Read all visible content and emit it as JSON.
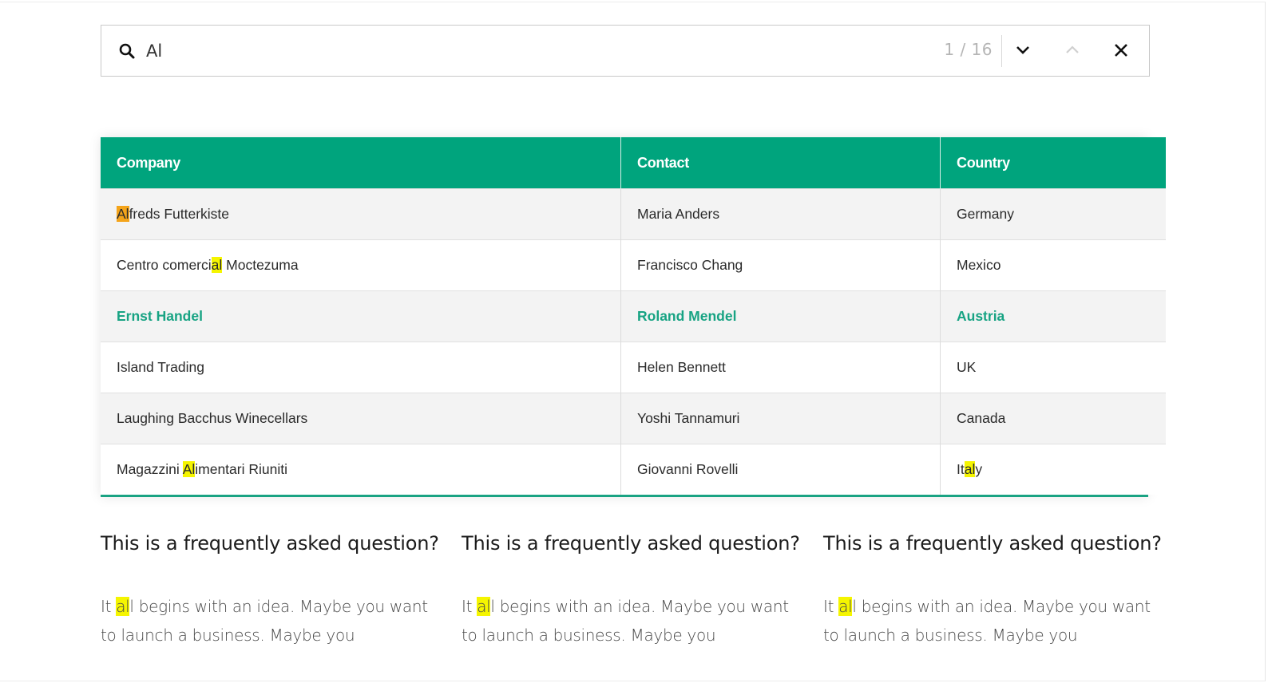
{
  "find_bar": {
    "query": "Al",
    "placeholder": "",
    "match_current": 1,
    "match_total": 16,
    "count_text": "1 / 16",
    "icons": {
      "search": "search-icon",
      "next": "chevron-down-icon",
      "prev": "chevron-up-icon",
      "close": "close-icon"
    }
  },
  "table": {
    "columns": [
      "Company",
      "Contact",
      "Country"
    ],
    "rows": [
      {
        "company": {
          "pre": "",
          "hl": "Al",
          "post": "freds Futterkiste",
          "current": true
        },
        "contact": "Maria Anders",
        "country": {
          "pre": "Germany",
          "hl": "",
          "post": ""
        }
      },
      {
        "company": {
          "pre": "Centro comerci",
          "hl": "al",
          "post": " Moctezuma"
        },
        "contact": "Francisco Chang",
        "country": {
          "pre": "Mexico",
          "hl": "",
          "post": ""
        }
      },
      {
        "company": {
          "pre": "Ernst Handel",
          "hl": "",
          "post": ""
        },
        "contact": "Roland Mendel",
        "country": {
          "pre": "Austria",
          "hl": "",
          "post": ""
        },
        "selected": true
      },
      {
        "company": {
          "pre": "Island Trading",
          "hl": "",
          "post": ""
        },
        "contact": "Helen Bennett",
        "country": {
          "pre": "UK",
          "hl": "",
          "post": ""
        }
      },
      {
        "company": {
          "pre": "Laughing Bacchus Winecellars",
          "hl": "",
          "post": ""
        },
        "contact": "Yoshi Tannamuri",
        "country": {
          "pre": "Canada",
          "hl": "",
          "post": ""
        }
      },
      {
        "company": {
          "pre": "Magazzini ",
          "hl": "Al",
          "post": "imentari Riuniti"
        },
        "contact": "Giovanni Rovelli",
        "country": {
          "pre": "It",
          "hl": "al",
          "post": "y"
        }
      }
    ]
  },
  "faq": [
    {
      "question": "This is a frequently asked question?",
      "answer_pre": "It ",
      "answer_hl": "al",
      "answer_post": "l begins with an idea. Maybe you want to launch a business. Maybe you"
    },
    {
      "question": "This is a frequently asked question?",
      "answer_pre": "It ",
      "answer_hl": "al",
      "answer_post": "l begins with an idea. Maybe you want to launch a business. Maybe you"
    },
    {
      "question": "This is a frequently asked question?",
      "answer_pre": "It ",
      "answer_hl": "al",
      "answer_post": "l begins with an idea. Maybe you want to launch a business. Maybe you"
    }
  ],
  "colors": {
    "accent": "#00a47d",
    "highlight": "#f5f500",
    "current_highlight": "#f4a41a",
    "selected_text": "#17a383"
  }
}
